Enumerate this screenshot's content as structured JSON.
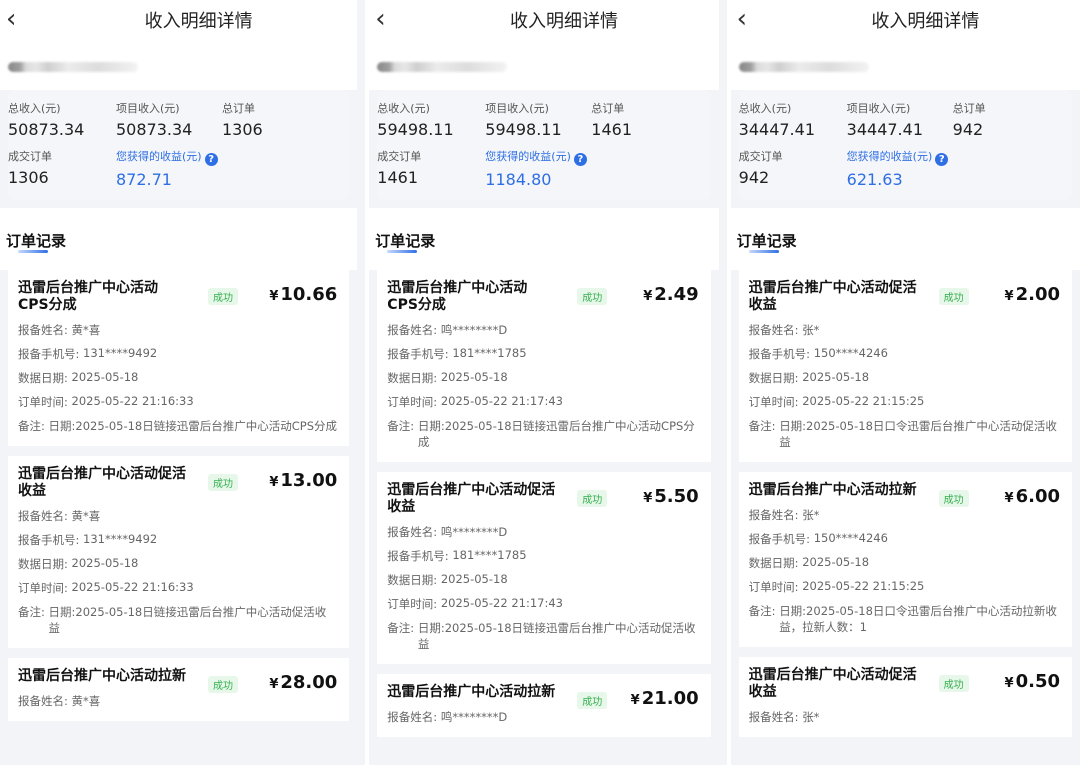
{
  "screens": [
    {
      "title": "收入明细详情",
      "stats": {
        "total_income_label": "总收入(元)",
        "total_income": "50873.34",
        "project_income_label": "项目收入(元)",
        "project_income": "50873.34",
        "total_orders_label": "总订单",
        "total_orders": "1306",
        "deal_orders_label": "成交订单",
        "deal_orders": "1306",
        "earnings_label": "您获得的收益(元)",
        "earnings": "872.71"
      },
      "section_title": "订单记录",
      "cards": [
        {
          "name": "迅雷后台推广中心活动CPS分成",
          "status": "成功",
          "amount": "10.66",
          "reporter_label": "报备姓名:",
          "reporter": "黄*喜",
          "phone_label": "报备手机号:",
          "phone": "131****9492",
          "date_label": "数据日期:",
          "date": "2025-05-18",
          "time_label": "订单时间:",
          "time": "2025-05-22 21:16:33",
          "note_label": "备注:",
          "note": "日期:2025-05-18日链接迅雷后台推广中心活动CPS分成"
        },
        {
          "name": "迅雷后台推广中心活动促活收益",
          "status": "成功",
          "amount": "13.00",
          "reporter_label": "报备姓名:",
          "reporter": "黄*喜",
          "phone_label": "报备手机号:",
          "phone": "131****9492",
          "date_label": "数据日期:",
          "date": "2025-05-18",
          "time_label": "订单时间:",
          "time": "2025-05-22 21:16:33",
          "note_label": "备注:",
          "note": "日期:2025-05-18日链接迅雷后台推广中心活动促活收益"
        },
        {
          "name": "迅雷后台推广中心活动拉新",
          "status": "成功",
          "amount": "28.00",
          "reporter_label": "报备姓名:",
          "reporter": "黄*喜"
        }
      ]
    },
    {
      "title": "收入明细详情",
      "stats": {
        "total_income_label": "总收入(元)",
        "total_income": "59498.11",
        "project_income_label": "项目收入(元)",
        "project_income": "59498.11",
        "total_orders_label": "总订单",
        "total_orders": "1461",
        "deal_orders_label": "成交订单",
        "deal_orders": "1461",
        "earnings_label": "您获得的收益(元)",
        "earnings": "1184.80"
      },
      "section_title": "订单记录",
      "cards": [
        {
          "name": "迅雷后台推广中心活动CPS分成",
          "status": "成功",
          "amount": "2.49",
          "reporter_label": "报备姓名:",
          "reporter": "鸣********D",
          "phone_label": "报备手机号:",
          "phone": "181****1785",
          "date_label": "数据日期:",
          "date": "2025-05-18",
          "time_label": "订单时间:",
          "time": "2025-05-22 21:17:43",
          "note_label": "备注:",
          "note": "日期:2025-05-18日链接迅雷后台推广中心活动CPS分成"
        },
        {
          "name": "迅雷后台推广中心活动促活收益",
          "status": "成功",
          "amount": "5.50",
          "reporter_label": "报备姓名:",
          "reporter": "鸣********D",
          "phone_label": "报备手机号:",
          "phone": "181****1785",
          "date_label": "数据日期:",
          "date": "2025-05-18",
          "time_label": "订单时间:",
          "time": "2025-05-22 21:17:43",
          "note_label": "备注:",
          "note": "日期:2025-05-18日链接迅雷后台推广中心活动促活收益"
        },
        {
          "name": "迅雷后台推广中心活动拉新",
          "status": "成功",
          "amount": "21.00",
          "reporter_label": "报备姓名:",
          "reporter": "鸣********D"
        }
      ]
    },
    {
      "title": "收入明细详情",
      "stats": {
        "total_income_label": "总收入(元)",
        "total_income": "34447.41",
        "project_income_label": "项目收入(元)",
        "project_income": "34447.41",
        "total_orders_label": "总订单",
        "total_orders": "942",
        "deal_orders_label": "成交订单",
        "deal_orders": "942",
        "earnings_label": "您获得的收益(元)",
        "earnings": "621.63"
      },
      "section_title": "订单记录",
      "cards": [
        {
          "name": "迅雷后台推广中心活动促活收益",
          "status": "成功",
          "amount": "2.00",
          "reporter_label": "报备姓名:",
          "reporter": "张*",
          "phone_label": "报备手机号:",
          "phone": "150****4246",
          "date_label": "数据日期:",
          "date": "2025-05-18",
          "time_label": "订单时间:",
          "time": "2025-05-22 21:15:25",
          "note_label": "备注:",
          "note": "日期:2025-05-18日口令迅雷后台推广中心活动促活收益"
        },
        {
          "name": "迅雷后台推广中心活动拉新",
          "status": "成功",
          "amount": "6.00",
          "reporter_label": "报备姓名:",
          "reporter": "张*",
          "phone_label": "报备手机号:",
          "phone": "150****4246",
          "date_label": "数据日期:",
          "date": "2025-05-18",
          "time_label": "订单时间:",
          "time": "2025-05-22 21:15:25",
          "note_label": "备注:",
          "note": "日期:2025-05-18日口令迅雷后台推广中心活动拉新收益，拉新人数：1"
        },
        {
          "name": "迅雷后台推广中心活动促活收益",
          "status": "成功",
          "amount": "0.50",
          "reporter_label": "报备姓名:",
          "reporter": "张*"
        }
      ]
    }
  ],
  "currency_symbol": "¥",
  "help_glyph": "?",
  "back_glyph": "‹",
  "colors": {
    "accent": "#2f6fe4",
    "success": "#36b04f",
    "success_bg": "#e7f7ea"
  }
}
